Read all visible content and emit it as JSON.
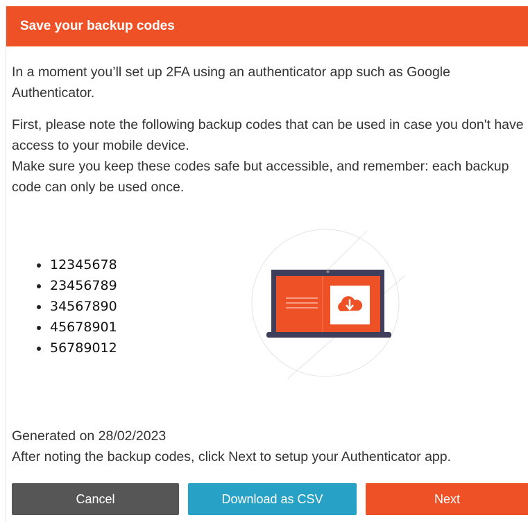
{
  "header": {
    "title": "Save your backup codes"
  },
  "intro": {
    "line1": "In a moment you’ll set up 2FA using an authenticator app such as Google Authenticator.",
    "line2": "First, please note the following backup codes that can be used in case you don't have access to your mobile device.",
    "line3": "Make sure you keep these codes safe but accessible, and remember: each backup code can only be used once."
  },
  "backup_codes": [
    "12345678",
    "23456789",
    "34567890",
    "45678901",
    "56789012"
  ],
  "illustration": {
    "icon": "laptop-download-icon",
    "colors": {
      "accent": "#ee5126",
      "frame": "#3f3f5c"
    }
  },
  "footer": {
    "generated": "Generated on 28/02/2023",
    "instruction": "After noting the backup codes, click Next to setup your Authenticator app."
  },
  "buttons": {
    "cancel": "Cancel",
    "download_csv": "Download as CSV",
    "next": "Next"
  },
  "colors": {
    "brand": "#ee5126",
    "secondary": "#27a2c6",
    "neutral": "#565656"
  }
}
